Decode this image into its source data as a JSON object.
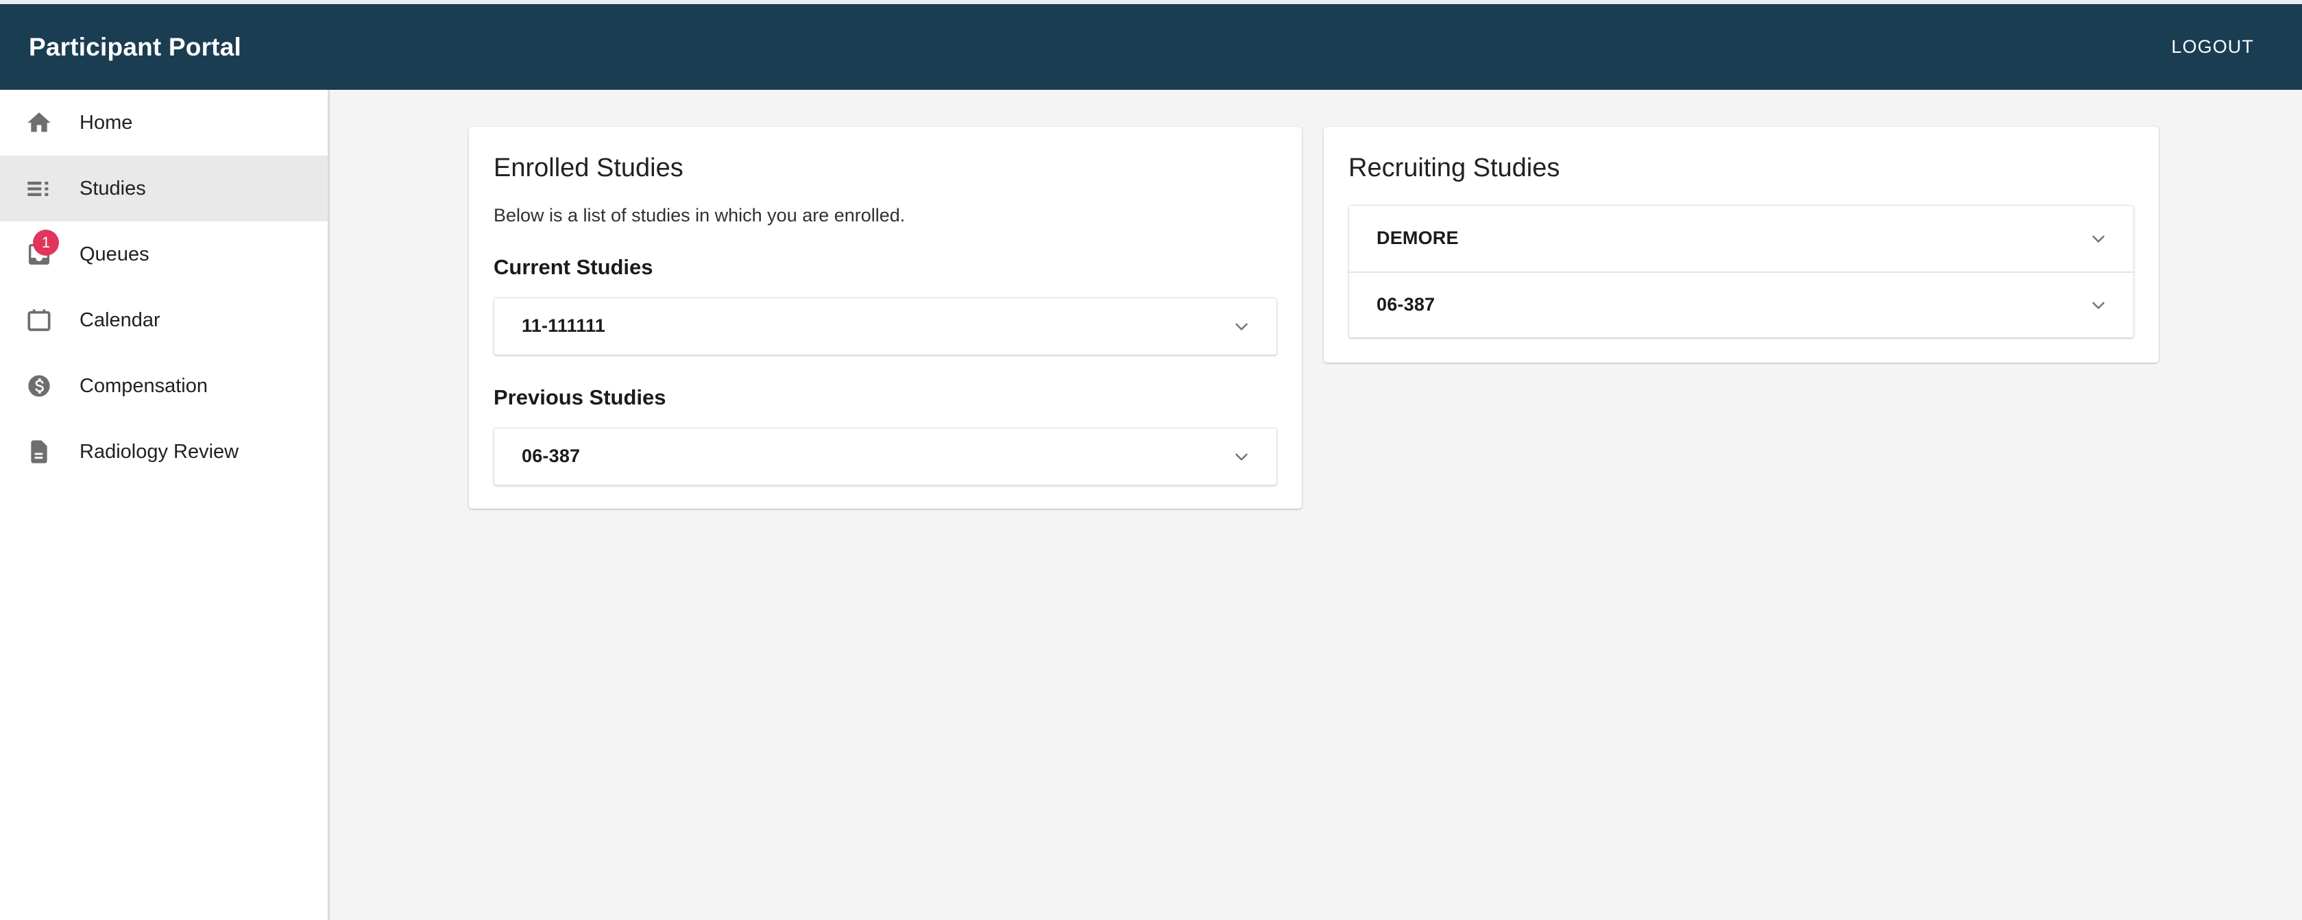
{
  "header": {
    "title": "Participant Portal",
    "logout_label": "LOGOUT",
    "bar_color": "#1a3d52"
  },
  "sidebar": {
    "items": [
      {
        "label": "Home",
        "icon": "home-icon",
        "active": false,
        "badge": null
      },
      {
        "label": "Studies",
        "icon": "list-icon",
        "active": true,
        "badge": null
      },
      {
        "label": "Queues",
        "icon": "inbox-icon",
        "active": false,
        "badge": "1"
      },
      {
        "label": "Calendar",
        "icon": "calendar-icon",
        "active": false,
        "badge": null
      },
      {
        "label": "Compensation",
        "icon": "dollar-circle-icon",
        "active": false,
        "badge": null
      },
      {
        "label": "Radiology Review",
        "icon": "document-icon",
        "active": false,
        "badge": null
      }
    ],
    "badge_color": "#e0355c",
    "active_background": "#e9e9e9"
  },
  "enrolled_card": {
    "title": "Enrolled Studies",
    "description": "Below is a list of studies in which you are enrolled.",
    "current_section_title": "Current Studies",
    "current_studies": [
      {
        "label": "11-111111",
        "expanded": false
      }
    ],
    "previous_section_title": "Previous Studies",
    "previous_studies": [
      {
        "label": "06-387",
        "expanded": false
      }
    ]
  },
  "recruiting_card": {
    "title": "Recruiting Studies",
    "studies": [
      {
        "label": "DEMORE",
        "expanded": false
      },
      {
        "label": "06-387",
        "expanded": false
      }
    ]
  }
}
